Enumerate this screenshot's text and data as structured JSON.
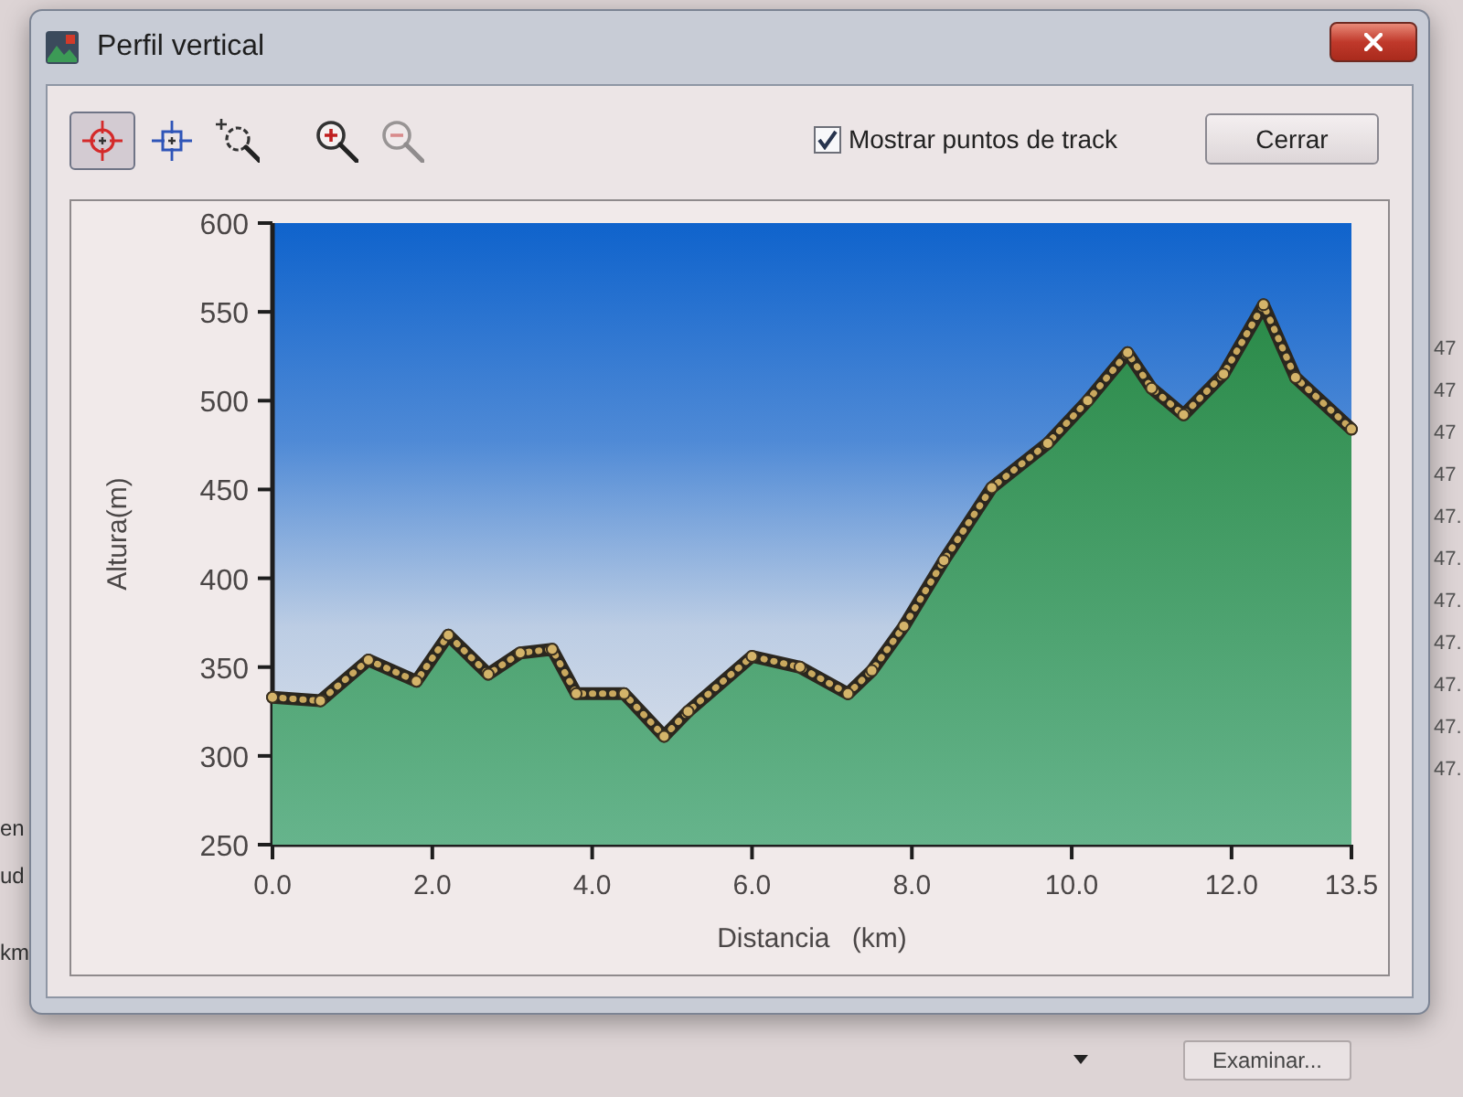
{
  "window": {
    "title": "Perfil vertical"
  },
  "toolbar": {
    "tools": [
      {
        "kind": "pointer",
        "selected": true,
        "disabled": false
      },
      {
        "kind": "select",
        "selected": false,
        "disabled": false
      },
      {
        "kind": "zoom-area",
        "selected": false,
        "disabled": false
      },
      {
        "kind": "zoom-in",
        "selected": false,
        "disabled": false
      },
      {
        "kind": "zoom-out",
        "selected": false,
        "disabled": true
      }
    ],
    "show_track_points": {
      "label": "Mostrar puntos de track",
      "checked": true
    },
    "close_button": "Cerrar"
  },
  "chart": {
    "chart_data": {
      "type": "area",
      "xlabel": "Distancia (km)",
      "ylabel": "Altura(m)",
      "x": [
        0,
        0.6,
        1.2,
        1.8,
        2.2,
        2.7,
        3.1,
        3.5,
        3.8,
        4.4,
        4.9,
        5.2,
        6.0,
        6.6,
        7.2,
        7.5,
        7.9,
        8.4,
        9.0,
        9.7,
        10.2,
        10.7,
        11.0,
        11.4,
        11.9,
        12.4,
        12.8,
        13.5
      ],
      "values": [
        333,
        331,
        354,
        342,
        368,
        346,
        358,
        360,
        335,
        335,
        311,
        325,
        356,
        350,
        335,
        348,
        373,
        410,
        451,
        476,
        500,
        527,
        507,
        492,
        515,
        554,
        513,
        484
      ],
      "xlim": [
        0,
        13.5
      ],
      "ylim": [
        250,
        600
      ],
      "xticks": [
        {
          "value": 0,
          "label": "0.0"
        },
        {
          "value": 2,
          "label": "2.0"
        },
        {
          "value": 4,
          "label": "4.0"
        },
        {
          "value": 6,
          "label": "6.0"
        },
        {
          "value": 8,
          "label": "8.0"
        },
        {
          "value": 10,
          "label": "10.0"
        },
        {
          "value": 12,
          "label": "12.0"
        },
        {
          "value": 13.5,
          "label": "13.5"
        }
      ],
      "yticks": [
        250,
        300,
        350,
        400,
        450,
        500,
        550,
        600
      ]
    }
  },
  "background_window": {
    "left_column": [
      "en",
      "ud",
      "km"
    ],
    "right_column": [
      "47",
      "47",
      "47",
      "47",
      "47.",
      "47.",
      "47.",
      "47.",
      "47.",
      "47.",
      "47."
    ],
    "browse_button": "Examinar..."
  }
}
